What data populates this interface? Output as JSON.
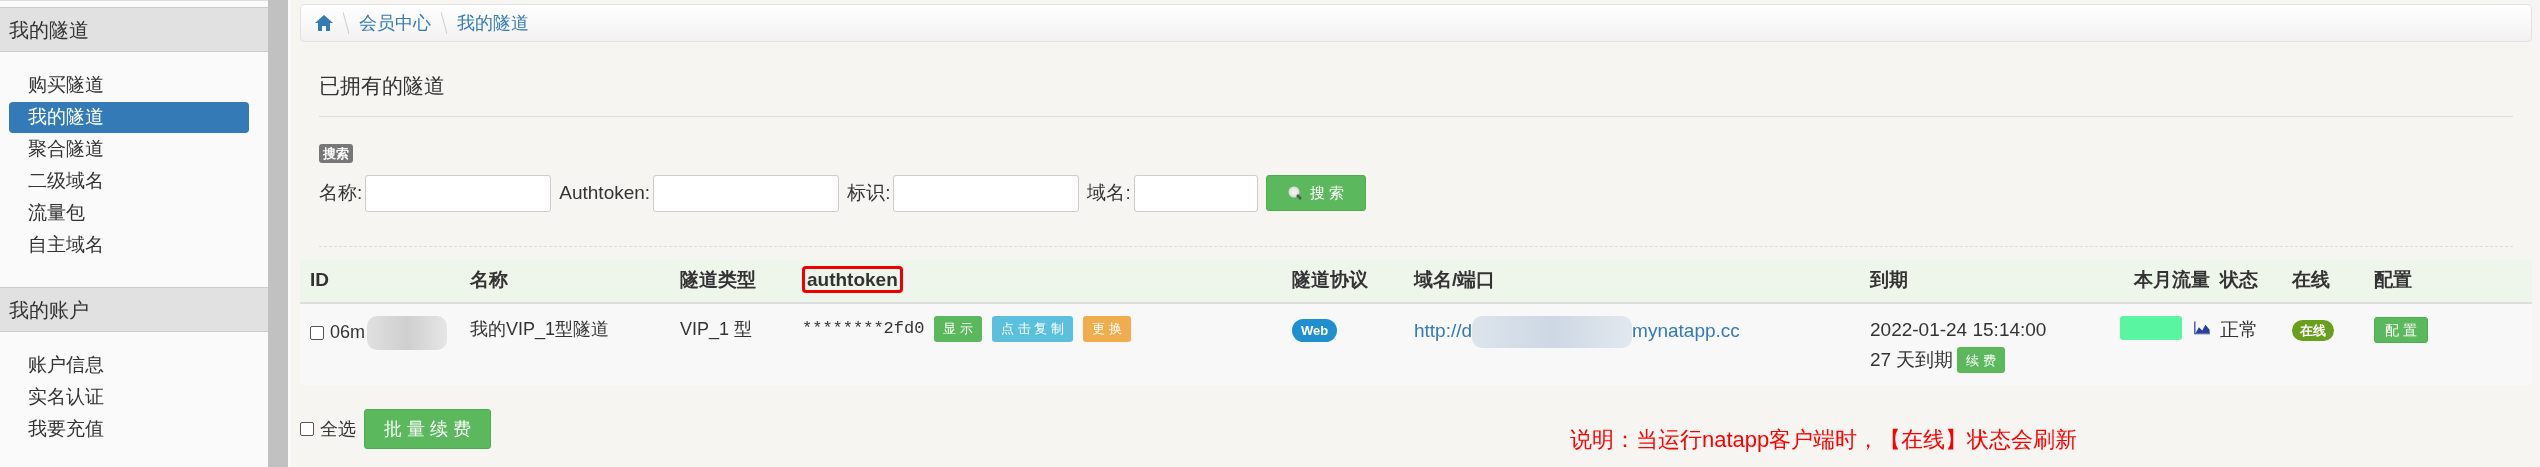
{
  "sidebar": {
    "sections": [
      {
        "title": "我的隧道",
        "items": [
          {
            "label": "购买隧道",
            "selected": false
          },
          {
            "label": "我的隧道",
            "selected": true
          },
          {
            "label": "聚合隧道",
            "selected": false
          },
          {
            "label": "二级域名",
            "selected": false
          },
          {
            "label": "流量包",
            "selected": false
          },
          {
            "label": "自主域名",
            "selected": false
          }
        ]
      },
      {
        "title": "我的账户",
        "items": [
          {
            "label": "账户信息",
            "selected": false
          },
          {
            "label": "实名认证",
            "selected": false
          },
          {
            "label": "我要充值",
            "selected": false
          }
        ]
      }
    ]
  },
  "breadcrumb": [
    "会员中心",
    "我的隧道"
  ],
  "page_title": "已拥有的隧道",
  "search": {
    "badge": "搜索",
    "fields": [
      {
        "label": "名称:"
      },
      {
        "label": "Authtoken:"
      },
      {
        "label": "标识:"
      },
      {
        "label": "域名:"
      }
    ],
    "button": "搜 索"
  },
  "table": {
    "columns": [
      "ID",
      "名称",
      "隧道类型",
      "authtoken",
      "隧道协议",
      "域名/端口",
      "到期",
      "本月流量",
      "状态",
      "在线",
      "配置"
    ],
    "rows": [
      {
        "checked": false,
        "id": "06m",
        "name": "我的VIP_1型隧道",
        "type": "VIP_1 型",
        "authtoken": "********2fd0",
        "token_buttons": [
          "显 示",
          "点 击 复 制",
          "更 换"
        ],
        "protocol": "Web",
        "domain_start": "http://d",
        "domain_end": "mynatapp.cc",
        "expires": "2022-01-24 15:14:00",
        "days_left": "27 天到期",
        "renew_button": "续 费",
        "status": "正常",
        "online": "在线",
        "config_button": "配 置"
      }
    ]
  },
  "footer": {
    "select_all": {
      "label": "全选",
      "checked": false
    },
    "batch_button": "批 量 续 费"
  },
  "note": "说明：当运行natapp客户端时，【在线】状态会刷新"
}
